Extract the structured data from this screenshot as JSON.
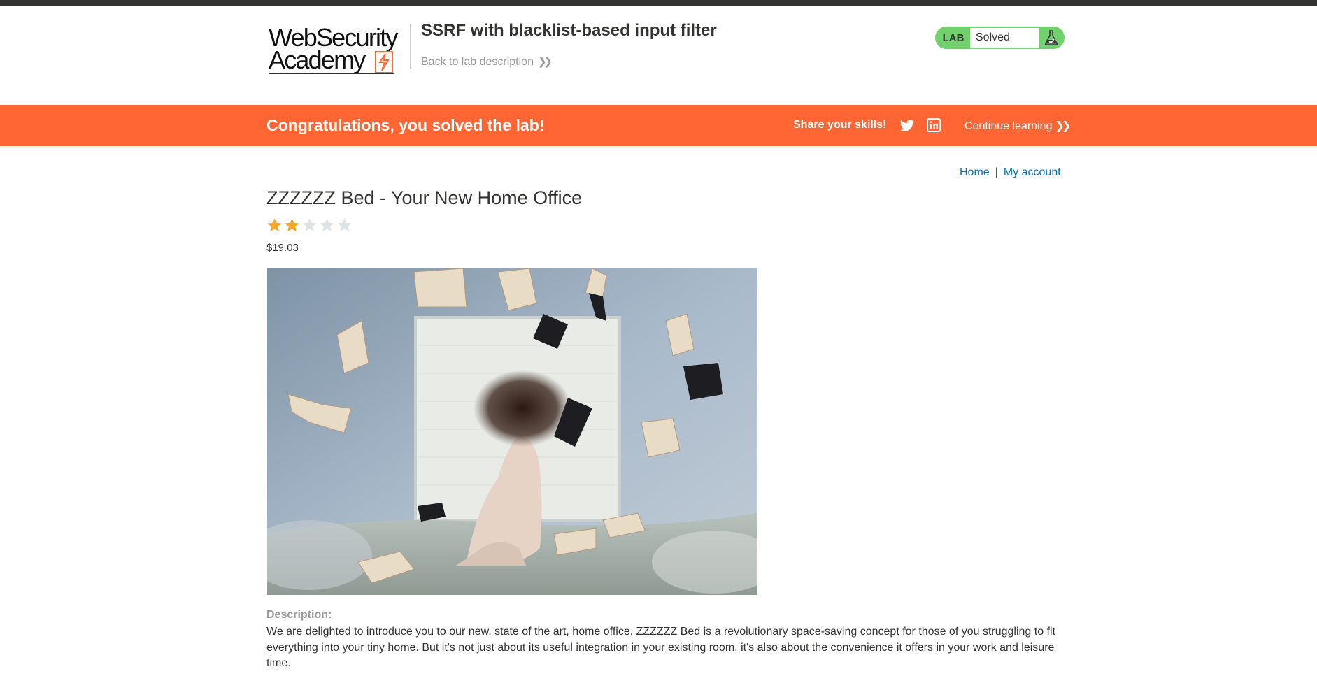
{
  "header": {
    "logo_line1": "WebSecurity",
    "logo_line2": "Academy",
    "lab_title": "SSRF with blacklist-based input filter",
    "back_link": "Back to lab description",
    "badge": {
      "label": "LAB",
      "status": "Solved",
      "icon": "flask-icon",
      "color": "#70d16d"
    }
  },
  "banner": {
    "message": "Congratulations, you solved the lab!",
    "share_label": "Share your skills!",
    "twitter_icon": "twitter-icon",
    "linkedin_icon": "linkedin-icon",
    "continue_label": "Continue learning",
    "color": "#ff6633"
  },
  "nav": {
    "home": "Home",
    "separator": "|",
    "account": "My account"
  },
  "product": {
    "title": "ZZZZZZ Bed - Your New Home Office",
    "rating": 2,
    "rating_max": 5,
    "price": "$19.03",
    "description_label": "Description:",
    "description": "We are delighted to introduce you to our new, state of the art, home office. ZZZZZZ Bed is a revolutionary space-saving concept for those of you struggling to fit everything into your tiny home. But it's not just about its useful integration in your existing room, it's also about the convenience it offers in your work and leisure time."
  }
}
